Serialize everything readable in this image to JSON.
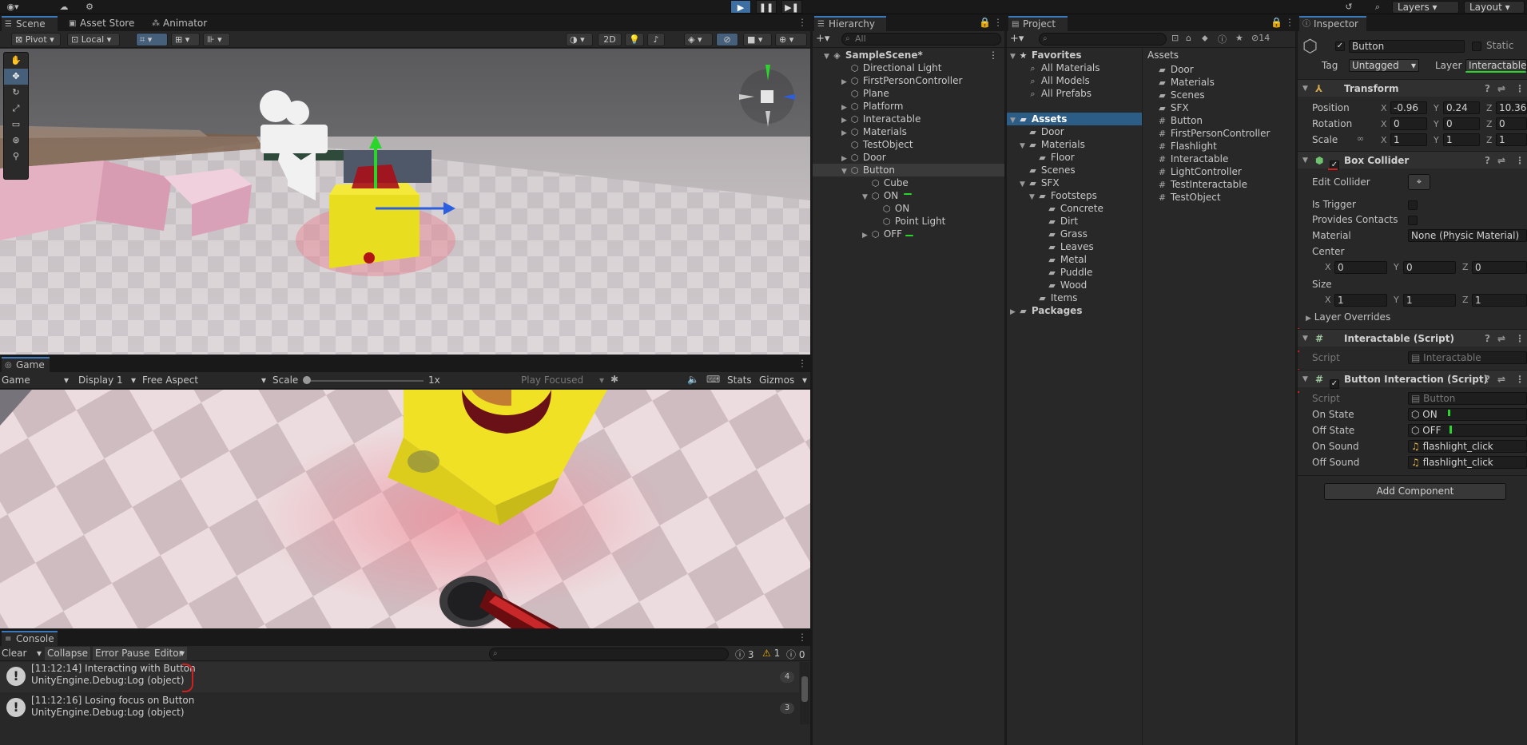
{
  "topbar": {
    "layers_label": "Layers",
    "layout_label": "Layout"
  },
  "scene": {
    "tabs": [
      {
        "label": "Scene"
      },
      {
        "label": "Asset Store"
      },
      {
        "label": "Animator"
      }
    ],
    "pivot_label": "Pivot",
    "local_label": "Local",
    "two_d_label": "2D"
  },
  "game": {
    "tab_label": "Game",
    "view_dropdown": "Game",
    "display_dropdown": "Display 1",
    "aspect_dropdown": "Free Aspect",
    "scale_label": "Scale",
    "scale_value": "1x",
    "play_focused": "Play Focused",
    "stats_label": "Stats",
    "gizmos_label": "Gizmos",
    "scale_slider_fraction": 0.0
  },
  "console": {
    "tab_label": "Console",
    "clear_label": "Clear",
    "collapse_label": "Collapse",
    "error_pause_label": "Error Pause",
    "editor_label": "Editor",
    "info_count": "3",
    "warn_count": "1",
    "error_count": "0",
    "entries": [
      {
        "line1": "[11:12:14] Interacting with Button",
        "line2": "UnityEngine.Debug:Log (object)",
        "count": "4"
      },
      {
        "line1": "[11:12:16] Losing focus on Button",
        "line2": "UnityEngine.Debug:Log (object)",
        "count": "3"
      }
    ]
  },
  "hierarchy": {
    "tab_label": "Hierarchy",
    "search_placeholder": "All",
    "scene_name": "SampleScene*",
    "items": [
      {
        "label": "Directional Light"
      },
      {
        "label": "FirstPersonController"
      },
      {
        "label": "Plane"
      },
      {
        "label": "Platform"
      },
      {
        "label": "Interactable"
      },
      {
        "label": "Materials"
      },
      {
        "label": "TestObject"
      },
      {
        "label": "Door"
      },
      {
        "label": "Button"
      },
      {
        "label": "Cube"
      },
      {
        "label": "ON"
      },
      {
        "label": "ON"
      },
      {
        "label": "Point Light"
      },
      {
        "label": "OFF"
      }
    ]
  },
  "project": {
    "tab_label": "Project",
    "hidden_count": "14",
    "favorites_label": "Favorites",
    "favorites": [
      "All Materials",
      "All Models",
      "All Prefabs"
    ],
    "assets_label": "Assets",
    "tree": [
      "Door",
      "Materials",
      "Floor",
      "Scenes",
      "SFX",
      "Footsteps",
      "Concrete",
      "Dirt",
      "Grass",
      "Leaves",
      "Metal",
      "Puddle",
      "Wood",
      "Items"
    ],
    "packages_label": "Packages",
    "assets_header": "Assets",
    "asset_files": [
      "Door",
      "Materials",
      "Scenes",
      "SFX",
      "Button",
      "FirstPersonController",
      "Flashlight",
      "Interactable",
      "LightController",
      "TestInteractable",
      "TestObject"
    ]
  },
  "inspector": {
    "tab_label": "Inspector",
    "object_name": "Button",
    "static_label": "Static",
    "tag_label": "Tag",
    "tag_value": "Untagged",
    "layer_label": "Layer",
    "layer_value": "Interactable",
    "transform": {
      "title": "Transform",
      "position_label": "Position",
      "rotation_label": "Rotation",
      "scale_label": "Scale",
      "position": [
        "-0.96",
        "0.24",
        "10.36"
      ],
      "rotation": [
        "0",
        "0",
        "0"
      ],
      "scale": [
        "1",
        "1",
        "1"
      ]
    },
    "box_collider": {
      "title": "Box Collider",
      "edit_collider": "Edit Collider",
      "is_trigger": "Is Trigger",
      "provides_contacts": "Provides Contacts",
      "material_label": "Material",
      "material_value": "None (Physic Material)",
      "center_label": "Center",
      "center": [
        "0",
        "0",
        "0"
      ],
      "size_label": "Size",
      "size": [
        "1",
        "1",
        "1"
      ],
      "layer_overrides": "Layer Overrides"
    },
    "interactable_script": {
      "title": "Interactable (Script)",
      "script_label": "Script",
      "script_value": "Interactable"
    },
    "button_interaction": {
      "title": "Button Interaction (Script)",
      "script_label": "Script",
      "script_value": "Button",
      "on_state_label": "On State",
      "on_state_value": "ON",
      "off_state_label": "Off State",
      "off_state_value": "OFF",
      "on_sound_label": "On Sound",
      "on_sound_value": "flashlight_click",
      "off_sound_label": "Off Sound",
      "off_sound_value": "flashlight_click"
    },
    "add_component": "Add Component",
    "axis": [
      "X",
      "Y",
      "Z"
    ]
  },
  "colors": {
    "accent": "#3a79bb",
    "annotation_green": "#29d629",
    "annotation_red": "#d02020"
  }
}
